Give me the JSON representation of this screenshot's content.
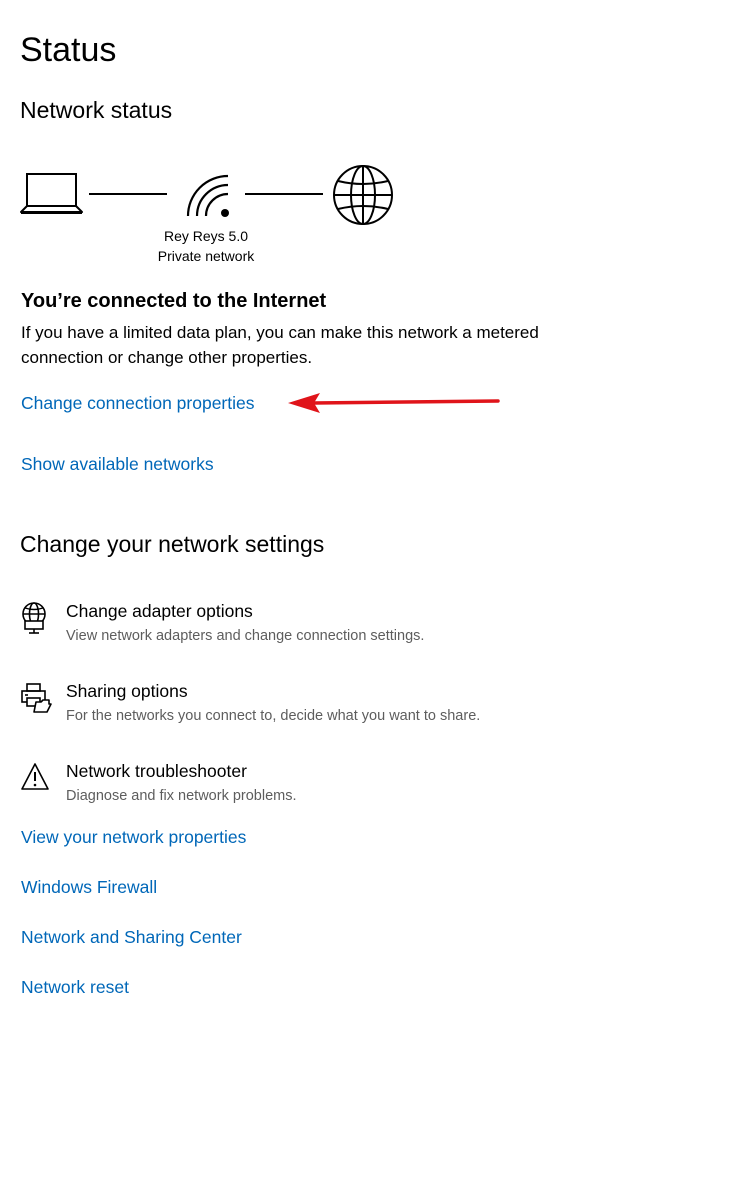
{
  "page": {
    "title": "Status"
  },
  "network_status": {
    "heading": "Network status",
    "network_name": "Rey Reys 5.0",
    "network_type": "Private network",
    "connected_title": "You’re connected to the Internet",
    "connected_desc": "If you have a limited data plan, you can make this network a metered connection or change other properties.",
    "change_connection_link": "Change connection properties",
    "show_networks_link": "Show available networks"
  },
  "settings_section": {
    "heading": "Change your network settings",
    "items": [
      {
        "icon": "globe-monitor-icon",
        "title": "Change adapter options",
        "desc": "View network adapters and change connection settings."
      },
      {
        "icon": "printer-share-icon",
        "title": "Sharing options",
        "desc": "For the networks you connect to, decide what you want to share."
      },
      {
        "icon": "warning-triangle-icon",
        "title": "Network troubleshooter",
        "desc": "Diagnose and fix network problems."
      }
    ]
  },
  "links": {
    "view_properties": "View your network properties",
    "firewall": "Windows Firewall",
    "sharing_center": "Network and Sharing Center",
    "reset": "Network reset"
  },
  "colors": {
    "link": "#0067b8",
    "annotation_arrow": "#e0141a",
    "description_text": "#5d5d5d"
  }
}
